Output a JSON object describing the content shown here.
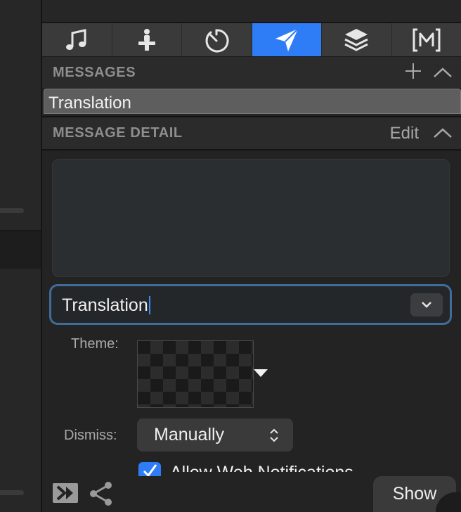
{
  "tabs": [
    {
      "name": "music-note-icon",
      "active": false
    },
    {
      "name": "stage-icon",
      "active": false
    },
    {
      "name": "timer-icon",
      "active": false
    },
    {
      "name": "send-message-icon",
      "active": true
    },
    {
      "name": "layers-icon",
      "active": false
    },
    {
      "name": "macro-icon",
      "active": false
    }
  ],
  "messages": {
    "title": "MESSAGES",
    "items": [
      {
        "label": "Translation",
        "selected": true
      }
    ]
  },
  "detail": {
    "title": "MESSAGE DETAIL",
    "edit_label": "Edit",
    "text_value": "Translation",
    "theme_label": "Theme:",
    "dismiss_label": "Dismiss:",
    "dismiss_value": "Manually",
    "checkbox_label": "Allow Web Notifications",
    "checkbox_checked": true
  },
  "footer": {
    "show_label": "Show"
  },
  "colors": {
    "accent": "#2f7df6",
    "focus_ring": "#3f6c98"
  }
}
